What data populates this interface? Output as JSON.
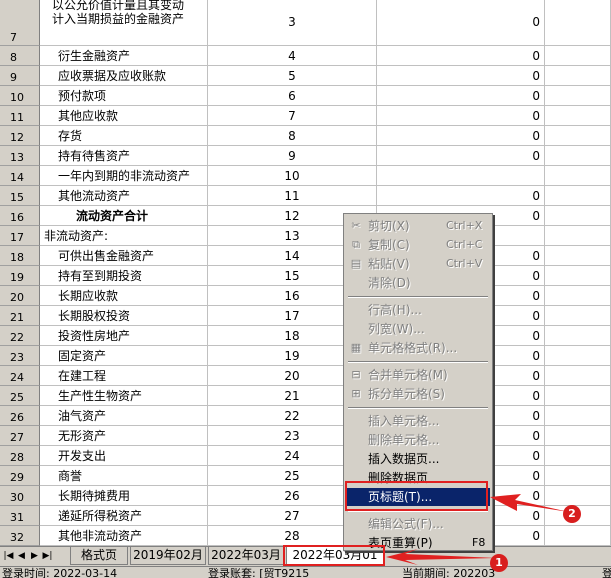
{
  "sheet": {
    "rows": [
      {
        "num": "7",
        "name": "以公允价值计量且其变动\n计入当期损益的金融资产",
        "line": "3",
        "value": "0"
      },
      {
        "num": "8",
        "name": "衍生金融资产",
        "line": "4",
        "value": "0"
      },
      {
        "num": "9",
        "name": "应收票据及应收账款",
        "line": "5",
        "value": "0"
      },
      {
        "num": "10",
        "name": "预付款项",
        "line": "6",
        "value": "0"
      },
      {
        "num": "11",
        "name": "其他应收款",
        "line": "7",
        "value": "0"
      },
      {
        "num": "12",
        "name": "存货",
        "line": "8",
        "value": "0"
      },
      {
        "num": "13",
        "name": "持有待售资产",
        "line": "9",
        "value": "0"
      },
      {
        "num": "14",
        "name": "一年内到期的非流动资产",
        "line": "10",
        "value": ""
      },
      {
        "num": "15",
        "name": "其他流动资产",
        "line": "11",
        "value": "0"
      },
      {
        "num": "16",
        "name": "流动资产合计",
        "line": "12",
        "value": "0",
        "bold": true
      },
      {
        "num": "17",
        "name": "非流动资产:",
        "line": "13",
        "value": ""
      },
      {
        "num": "18",
        "name": "可供出售金融资产",
        "line": "14",
        "value": "0"
      },
      {
        "num": "19",
        "name": "持有至到期投资",
        "line": "15",
        "value": "0"
      },
      {
        "num": "20",
        "name": "长期应收款",
        "line": "16",
        "value": "0"
      },
      {
        "num": "21",
        "name": "长期股权投资",
        "line": "17",
        "value": "0"
      },
      {
        "num": "22",
        "name": "投资性房地产",
        "line": "18",
        "value": "0"
      },
      {
        "num": "23",
        "name": "固定资产",
        "line": "19",
        "value": "0"
      },
      {
        "num": "24",
        "name": "在建工程",
        "line": "20",
        "value": "0"
      },
      {
        "num": "25",
        "name": "生产性生物资产",
        "line": "21",
        "value": "0"
      },
      {
        "num": "26",
        "name": "油气资产",
        "line": "22",
        "value": "0"
      },
      {
        "num": "27",
        "name": "无形资产",
        "line": "23",
        "value": "0"
      },
      {
        "num": "28",
        "name": "开发支出",
        "line": "24",
        "value": "0"
      },
      {
        "num": "29",
        "name": "商誉",
        "line": "25",
        "value": "0"
      },
      {
        "num": "30",
        "name": "长期待摊费用",
        "line": "26",
        "value": "0"
      },
      {
        "num": "31",
        "name": "递延所得税资产",
        "line": "27",
        "value": "0"
      },
      {
        "num": "32",
        "name": "其他非流动资产",
        "line": "28",
        "value": "0"
      }
    ]
  },
  "tabs": [
    {
      "label": "格式页",
      "active": false
    },
    {
      "label": "2019年02月",
      "active": false
    },
    {
      "label": "2022年03月",
      "active": false
    },
    {
      "label": "2022年03月01",
      "active": true
    }
  ],
  "status": {
    "login_time": "登录时间: 2022-03-14",
    "account": "登录账套: [贸T9215",
    "period": "当前期间: 202203",
    "extra": "登"
  },
  "context_menu": {
    "items": [
      {
        "label": "剪切(X)",
        "shortcut": "Ctrl+X",
        "icon": "scissors-icon",
        "glyph": "✂",
        "disabled": true
      },
      {
        "label": "复制(C)",
        "shortcut": "Ctrl+C",
        "icon": "copy-icon",
        "glyph": "⧉",
        "disabled": true
      },
      {
        "label": "粘贴(V)",
        "shortcut": "Ctrl+V",
        "icon": "paste-icon",
        "glyph": "▤",
        "disabled": true
      },
      {
        "label": "清除(D)",
        "shortcut": "",
        "icon": "",
        "glyph": "",
        "disabled": true
      },
      {
        "sep": true
      },
      {
        "label": "行高(H)...",
        "shortcut": "",
        "icon": "",
        "glyph": "",
        "disabled": true
      },
      {
        "label": "列宽(W)...",
        "shortcut": "",
        "icon": "",
        "glyph": "",
        "disabled": true
      },
      {
        "label": "单元格格式(R)...",
        "shortcut": "",
        "icon": "cell-format-icon",
        "glyph": "▦",
        "disabled": true
      },
      {
        "sep": true
      },
      {
        "label": "合并单元格(M)",
        "shortcut": "",
        "icon": "merge-cells-icon",
        "glyph": "⊟",
        "disabled": true
      },
      {
        "label": "拆分单元格(S)",
        "shortcut": "",
        "icon": "split-cells-icon",
        "glyph": "⊞",
        "disabled": true
      },
      {
        "sep": true
      },
      {
        "label": "插入单元格...",
        "shortcut": "",
        "icon": "",
        "glyph": "",
        "disabled": true
      },
      {
        "label": "删除单元格...",
        "shortcut": "",
        "icon": "",
        "glyph": "",
        "disabled": true
      },
      {
        "label": "插入数据页...",
        "shortcut": "",
        "icon": "",
        "glyph": "",
        "disabled": false
      },
      {
        "label": "删除数据页",
        "shortcut": "",
        "icon": "",
        "glyph": "",
        "disabled": false
      },
      {
        "label": "页标题(T)...",
        "shortcut": "",
        "icon": "",
        "glyph": "",
        "disabled": false,
        "selected": true
      },
      {
        "sep": true
      },
      {
        "label": "编辑公式(F)...",
        "shortcut": "",
        "icon": "",
        "glyph": "",
        "disabled": true
      },
      {
        "label": "表页重算(P)",
        "shortcut": "F8",
        "icon": "",
        "glyph": "",
        "disabled": false
      }
    ]
  },
  "annotations": {
    "badge1": "1",
    "badge2": "2",
    "color": "#e02020"
  }
}
